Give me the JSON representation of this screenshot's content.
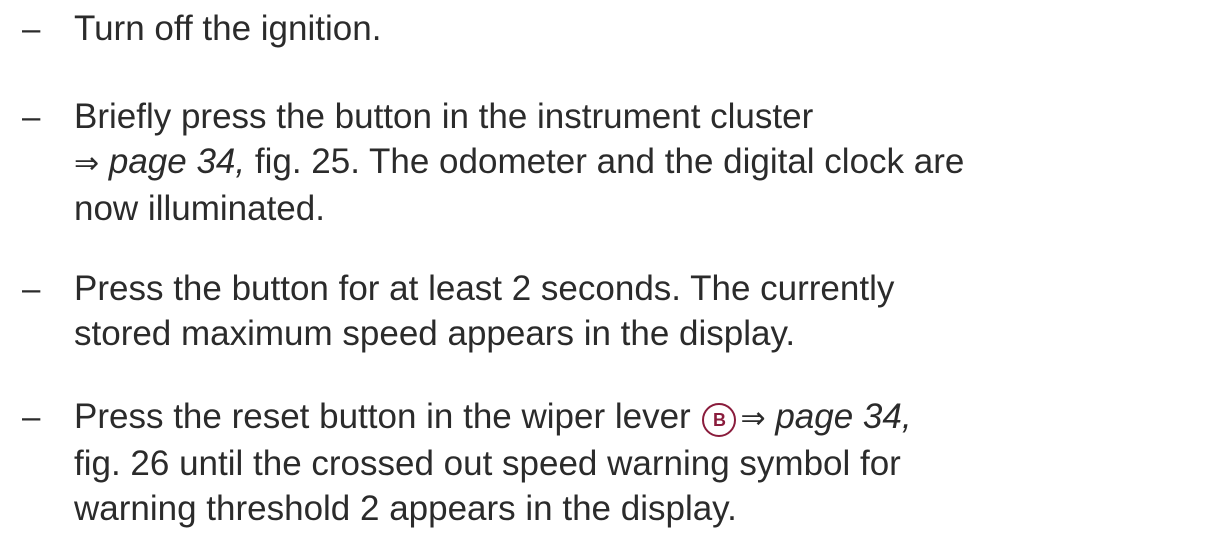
{
  "bullet": "–",
  "arrow": "⇒",
  "steps": [
    {
      "lines": [
        "Turn off the ignition."
      ]
    },
    {
      "line1": "Briefly press the button in the instrument cluster",
      "line2_ref": "page 34,",
      "line2_rest": " fig. 25. The odometer and the digital clock are",
      "line3": "now illuminated."
    },
    {
      "line1": "Press the button for at least 2 seconds. The currently",
      "line2": "stored maximum speed appears in the display."
    },
    {
      "line1_pre": "Press the reset button in the wiper lever ",
      "callout": "B",
      "line1_ref": "page 34,",
      "line2": "fig. 26 until the crossed out speed warning symbol for",
      "line3": "warning threshold 2 appears in the display."
    }
  ],
  "colors": {
    "text": "#2b2b2b",
    "callout": "#8a1c3c"
  }
}
